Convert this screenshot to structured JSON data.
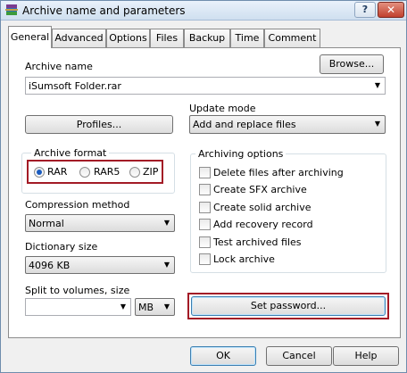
{
  "window": {
    "title": "Archive name and parameters",
    "help_label": "?",
    "close_label": "✕"
  },
  "tabs": [
    {
      "label": "General"
    },
    {
      "label": "Advanced"
    },
    {
      "label": "Options"
    },
    {
      "label": "Files"
    },
    {
      "label": "Backup"
    },
    {
      "label": "Time"
    },
    {
      "label": "Comment"
    }
  ],
  "archive_name": {
    "label": "Archive name",
    "value": "iSumsoft Folder.rar",
    "browse_label": "Browse..."
  },
  "profiles_label": "Profiles...",
  "update_mode": {
    "label": "Update mode",
    "value": "Add and replace files"
  },
  "archive_format": {
    "label": "Archive format",
    "options": [
      {
        "label": "RAR",
        "checked": true
      },
      {
        "label": "RAR5",
        "checked": false
      },
      {
        "label": "ZIP",
        "checked": false
      }
    ]
  },
  "archiving_options": {
    "label": "Archiving options",
    "items": [
      {
        "label": "Delete files after archiving",
        "checked": false
      },
      {
        "label": "Create SFX archive",
        "checked": false
      },
      {
        "label": "Create solid archive",
        "checked": false
      },
      {
        "label": "Add recovery record",
        "checked": false
      },
      {
        "label": "Test archived files",
        "checked": false
      },
      {
        "label": "Lock archive",
        "checked": false
      }
    ]
  },
  "compression_method": {
    "label": "Compression method",
    "value": "Normal"
  },
  "dictionary_size": {
    "label": "Dictionary size",
    "value": "4096 KB"
  },
  "split_volumes": {
    "label": "Split to volumes, size",
    "value": "",
    "unit": "MB"
  },
  "set_password_label": "Set password...",
  "footer": {
    "ok_label": "OK",
    "cancel_label": "Cancel",
    "help_label": "Help"
  },
  "highlight_color": "#a31b26"
}
